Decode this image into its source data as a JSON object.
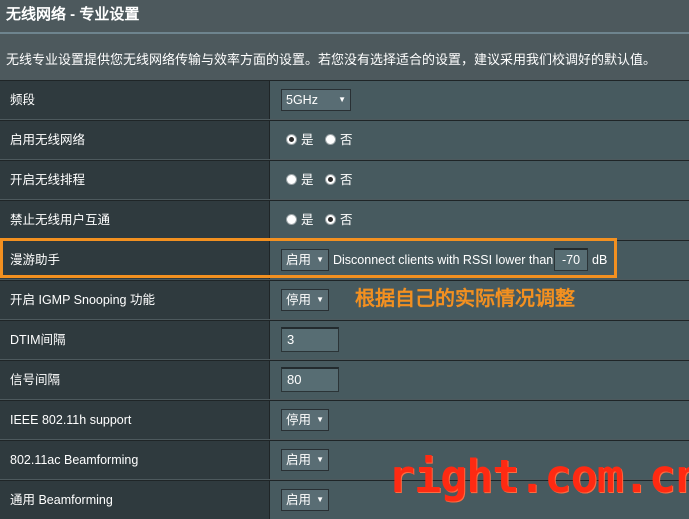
{
  "page": {
    "title": "无线网络 - 专业设置",
    "description": "无线专业设置提供您无线网络传输与效率方面的设置。若您没有选择适合的设置，建议采用我们校调好的默认值。"
  },
  "rows": {
    "band": {
      "label": "频段",
      "value": "5GHz"
    },
    "enable_radio": {
      "label": "启用无线网络",
      "yes": "是",
      "no": "否",
      "selected": "yes"
    },
    "schedule": {
      "label": "开启无线排程",
      "yes": "是",
      "no": "否",
      "selected": "no"
    },
    "isolation": {
      "label": "禁止无线用户互通",
      "yes": "是",
      "no": "否",
      "selected": "no"
    },
    "roaming": {
      "label": "漫游助手",
      "value": "启用",
      "rssi_text": "Disconnect clients with RSSI lower than",
      "rssi_value": "-70",
      "rssi_unit": "dB"
    },
    "igmp": {
      "label": "开启 IGMP Snooping 功能",
      "value": "停用"
    },
    "dtim": {
      "label": "DTIM间隔",
      "value": "3"
    },
    "beacon": {
      "label": "信号间隔",
      "value": "80"
    },
    "ieee80211h": {
      "label": "IEEE 802.11h support",
      "value": "停用"
    },
    "beamforming_ac": {
      "label": "802.11ac Beamforming",
      "value": "启用"
    },
    "beamforming_universal": {
      "label": "通用 Beamforming",
      "value": "启用"
    }
  },
  "overlay": {
    "annotation": "根据自己的实际情况调整",
    "watermark": "right.com.cn",
    "highlight_color": "#f39020",
    "watermark_color": "#ff2a12"
  },
  "icons": {
    "dropdown": "chevron-down-icon"
  }
}
